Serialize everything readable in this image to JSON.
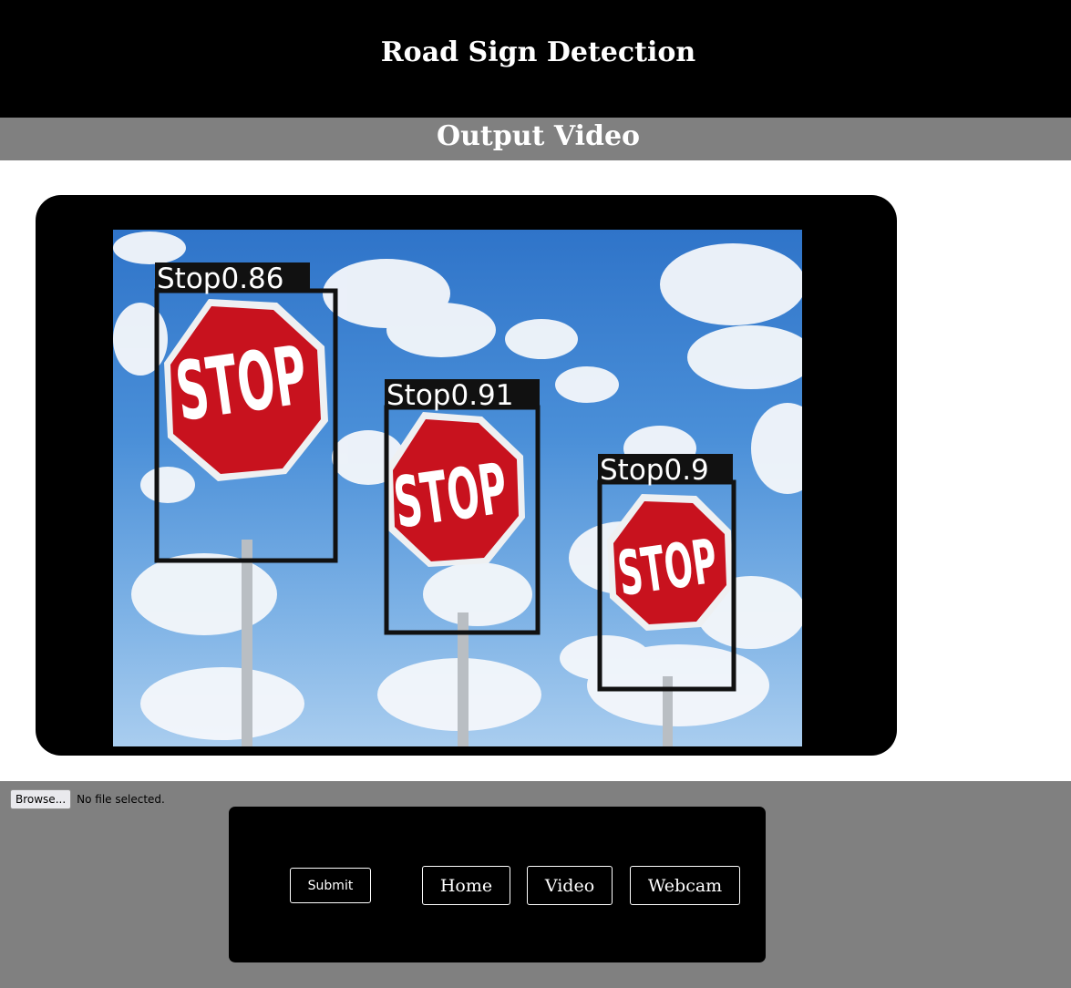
{
  "header": {
    "title": "Road Sign Detection"
  },
  "section": {
    "title": "Output Video"
  },
  "video": {
    "detections": [
      {
        "label": "Stop0.86",
        "sign_text": "STOP"
      },
      {
        "label": "Stop0.91",
        "sign_text": "STOP"
      },
      {
        "label": "Stop0.9",
        "sign_text": "STOP"
      }
    ]
  },
  "upload": {
    "browse_label": "Browse...",
    "status": "No file selected."
  },
  "nav": {
    "submit_label": "Submit",
    "home_label": "Home",
    "video_label": "Video",
    "webcam_label": "Webcam"
  },
  "colors": {
    "header_bg": "#000000",
    "subheader_bg": "#808080",
    "sign_red": "#c8121e"
  }
}
